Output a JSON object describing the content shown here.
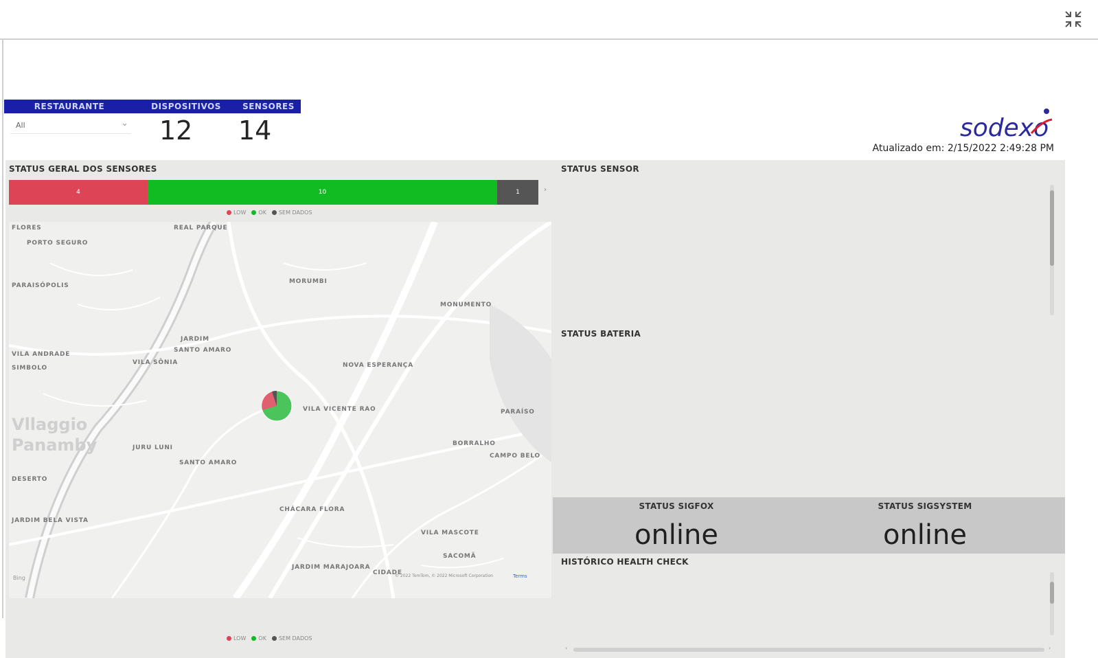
{
  "header": {
    "kpi_labels": [
      "RESTAURANTE",
      "DISPOSITIVOS",
      "SENSORES"
    ],
    "slicer_value": "All",
    "devices_count": "12",
    "sensors_count": "14",
    "updated_text": "Atualizado em: 2/15/2022 2:49:28 PM"
  },
  "brand": {
    "logo_text": "sodexo",
    "logo_color": "#2a2a9e",
    "logo_accent": "#e01a2d"
  },
  "general_status": {
    "title": "STATUS GERAL DOS SENSORES",
    "legend": [
      "LOW",
      "OK",
      "SEM DADOS"
    ],
    "colors": {
      "low": "#dd4455",
      "ok": "#11bb22",
      "no_data": "#555555"
    }
  },
  "map": {
    "labels": [
      "FLORES",
      "PORTO SEGURO",
      "REAL PARQUE",
      "PARAISÓPOLIS",
      "MORUMBI",
      "MONUMENTO",
      "JARDIM",
      "SANTO AMARO",
      "VILA SÔNIA",
      "VILA ANDRADE",
      "SIMBOLO",
      "DESERTO",
      "JARDIM BELA VISTA",
      "VILA VICENTE RAO",
      "NOVA ESPERANÇA",
      "PARAÍSO",
      "JURU LUNI",
      "SANTO AMARO",
      "CHÁCARA FLORA",
      "BORRALHO",
      "VILA MASCOTE",
      "SACOMÃ",
      "JARDIM MARAJOARA",
      "CIDADE",
      "CAMPO BELO"
    ],
    "watermark": [
      "Vllaggio",
      "Panamby"
    ],
    "attribution": "© 2022 TomTom, © 2022 Microsoft Corporation",
    "terms": "Terms",
    "bing_label": "Bing",
    "mark_colors": {
      "ok": "#4cc45c",
      "low": "#e06070",
      "no_data": "#555555"
    },
    "mark_share": {
      "ok": 0.71,
      "low": 0.21,
      "no_data": 0.08
    }
  },
  "right_panel": {
    "sensor_title": "STATUS SENSOR",
    "battery_title": "STATUS BATERIA",
    "sigfox_title": "STATUS SIGFOX",
    "sigfox_value": "online",
    "sigsystem_title": "STATUS SIGSYSTEM",
    "sigsystem_value": "online",
    "history_title": "HISTÓRICO HEALTH CHECK"
  },
  "icons": {
    "collapse": "collapse-icon",
    "dropdown": "chevron-down-icon"
  }
}
